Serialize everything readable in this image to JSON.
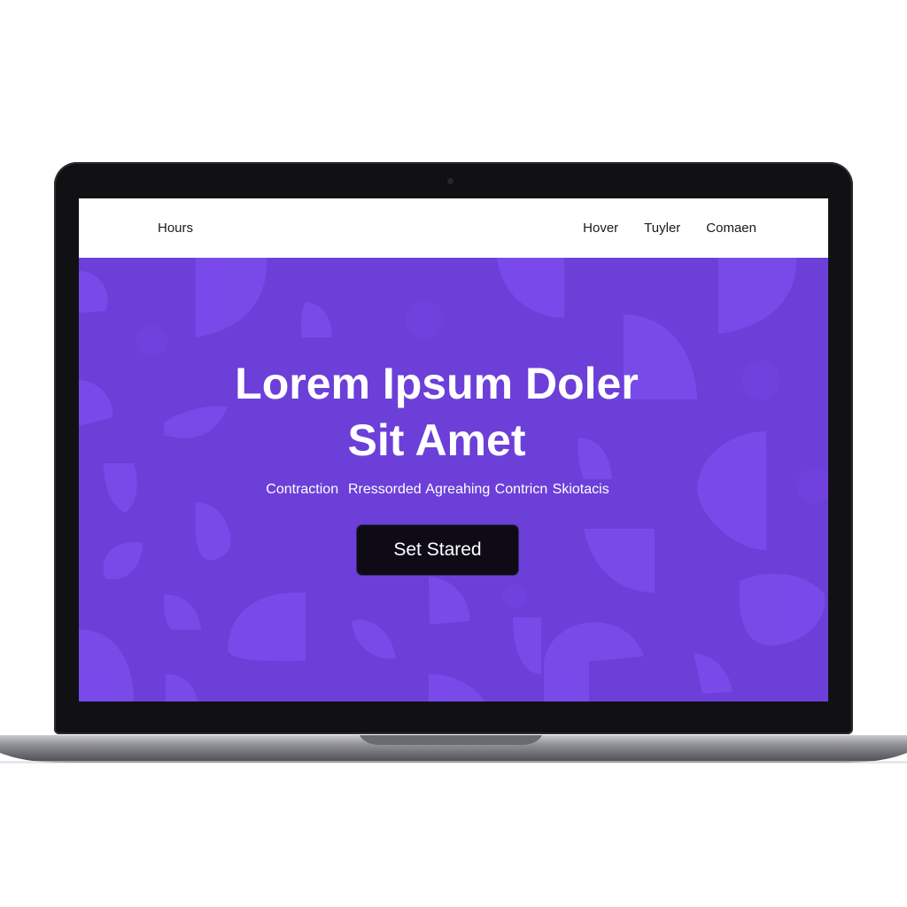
{
  "nav": {
    "brand": "Hours",
    "links": [
      "Hover",
      "Tuyler",
      "Comaen"
    ]
  },
  "hero": {
    "title_line1": "Lorem Ipsum Doler",
    "title_line2": "Sit Amet",
    "subtitle_part1": "Contraction",
    "subtitle_part2": "Rressorded Agreahing Contricn Skiotacis",
    "cta_label": "Set Stared"
  },
  "colors": {
    "hero_background": "#6c3fd9",
    "hero_shapes": "#7b4ceb",
    "cta_background": "#0e0b17",
    "laptop_bezel": "#111114",
    "laptop_body": "#8f9095"
  }
}
